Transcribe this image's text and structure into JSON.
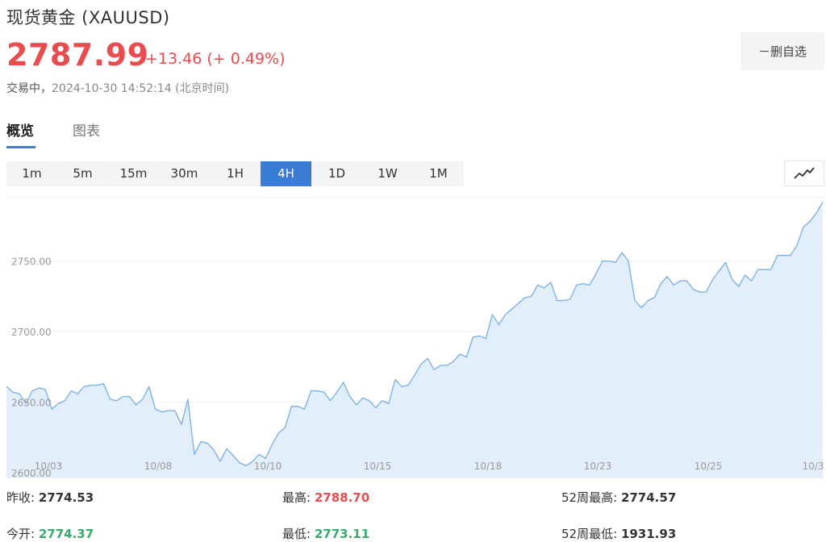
{
  "header": {
    "title": "现货黄金  (XAUUSD)",
    "price": "2787.99",
    "change": "+13.46 (+ 0.49%)",
    "status_label": "交易中，",
    "timestamp": "2024-10-30 14:52:14",
    "timezone": "(北京时间)",
    "fav_button": "－删自选"
  },
  "tabs": [
    {
      "label": "概览",
      "active": true
    },
    {
      "label": "图表",
      "active": false
    }
  ],
  "periods": [
    "1m",
    "5m",
    "15m",
    "30m",
    "1H",
    "4H",
    "1D",
    "1W",
    "1M"
  ],
  "active_period": "4H",
  "chart_type_icon": "line-chart-icon",
  "colors": {
    "up_red": "#e84c4f",
    "down_green": "#3aaa6e",
    "accent_blue": "#3a7bd5",
    "line": "#7fb2e5",
    "fill": "#e3eefb"
  },
  "chart_data": {
    "type": "area",
    "y_ticks": [
      "2600.00",
      "2650.00",
      "2700.00",
      "2750.00"
    ],
    "ylim": [
      2596,
      2795
    ],
    "x_labels": [
      "10/03",
      "10/08",
      "10/10",
      "10/15",
      "10/18",
      "10/23",
      "10/25",
      "10/3"
    ],
    "values": [
      2661,
      2657,
      2656,
      2649,
      2658,
      2660,
      2659,
      2645,
      2649,
      2651,
      2658,
      2656,
      2661,
      2662,
      2662,
      2663,
      2652,
      2651,
      2654,
      2654,
      2648,
      2652,
      2661,
      2645,
      2643,
      2644,
      2644,
      2634,
      2652,
      2613,
      2622,
      2621,
      2616,
      2608,
      2617,
      2612,
      2607,
      2605,
      2608,
      2613,
      2610,
      2620,
      2628,
      2632,
      2647,
      2647,
      2645,
      2658,
      2658,
      2657,
      2651,
      2657,
      2664,
      2654,
      2648,
      2653,
      2651,
      2646,
      2651,
      2649,
      2666,
      2661,
      2662,
      2669,
      2677,
      2681,
      2673,
      2676,
      2676,
      2679,
      2684,
      2682,
      2696,
      2697,
      2695,
      2712,
      2705,
      2712,
      2716,
      2720,
      2724,
      2725,
      2733,
      2731,
      2735,
      2722,
      2722,
      2723,
      2733,
      2734,
      2733,
      2741,
      2750,
      2750,
      2749,
      2756,
      2750,
      2722,
      2717,
      2722,
      2724,
      2734,
      2739,
      2733,
      2736,
      2736,
      2730,
      2728,
      2728,
      2737,
      2743,
      2749,
      2737,
      2732,
      2740,
      2736,
      2744,
      2744,
      2744,
      2754,
      2754,
      2754,
      2761,
      2774,
      2778,
      2784,
      2792
    ]
  },
  "stats": {
    "prev_close": {
      "label": "昨收:",
      "value": "2774.53"
    },
    "high": {
      "label": "最高:",
      "value": "2788.70"
    },
    "high_52w": {
      "label": "52周最高:",
      "value": "2774.57"
    },
    "open": {
      "label": "今开:",
      "value": "2774.37"
    },
    "low": {
      "label": "最低:",
      "value": "2773.11"
    },
    "low_52w": {
      "label": "52周最低:",
      "value": "1931.93"
    }
  }
}
